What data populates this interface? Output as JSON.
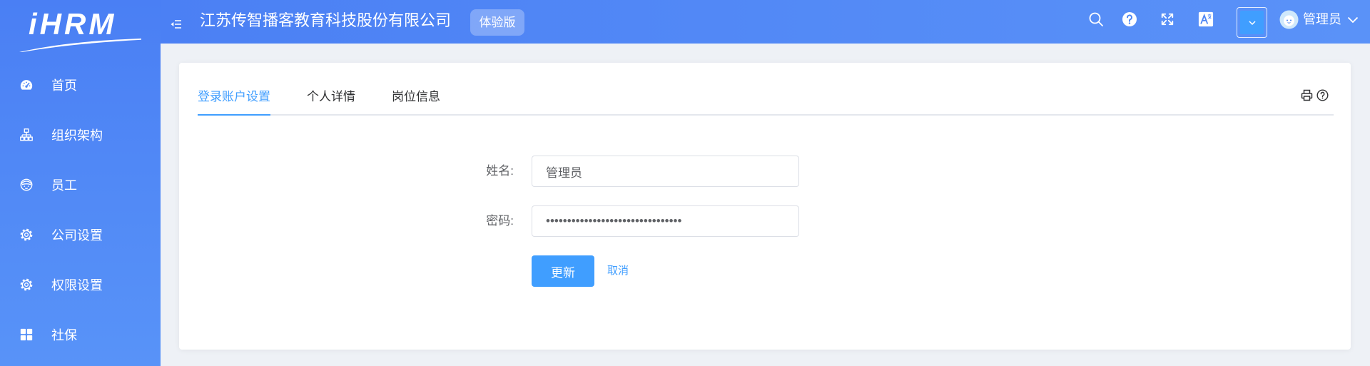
{
  "sidebar": {
    "logo_text": "iHRM",
    "items": [
      {
        "label": "首页",
        "icon": "dashboard-icon"
      },
      {
        "label": "组织架构",
        "icon": "org-chart-icon"
      },
      {
        "label": "员工",
        "icon": "employee-icon"
      },
      {
        "label": "公司设置",
        "icon": "gear-icon"
      },
      {
        "label": "权限设置",
        "icon": "gear-icon"
      },
      {
        "label": "社保",
        "icon": "grid-icon"
      }
    ]
  },
  "header": {
    "company_name": "江苏传智播客教育科技股份有限公司",
    "edition_badge": "体验版",
    "user_name": "管理员",
    "theme_color": "#409eff",
    "icons": [
      "collapse-menu-icon",
      "search-icon",
      "help-icon",
      "fullscreen-icon",
      "translate-icon",
      "avatar",
      "chevron-down-icon"
    ]
  },
  "tabs": {
    "items": [
      {
        "label": "登录账户设置",
        "active": true
      },
      {
        "label": "个人详情",
        "active": false
      },
      {
        "label": "岗位信息",
        "active": false
      }
    ],
    "tool_icons": [
      "print-icon",
      "help-circle-icon"
    ]
  },
  "form": {
    "name_label": "姓名:",
    "name_value": "管理员",
    "password_label": "密码:",
    "password_value": "••••••••••••••••••••••••••••••••",
    "submit_label": "更新",
    "cancel_label": "取消"
  },
  "colors": {
    "brand_blue": "#4d86f5",
    "accent": "#409eff",
    "page_background": "#eef1f6"
  }
}
